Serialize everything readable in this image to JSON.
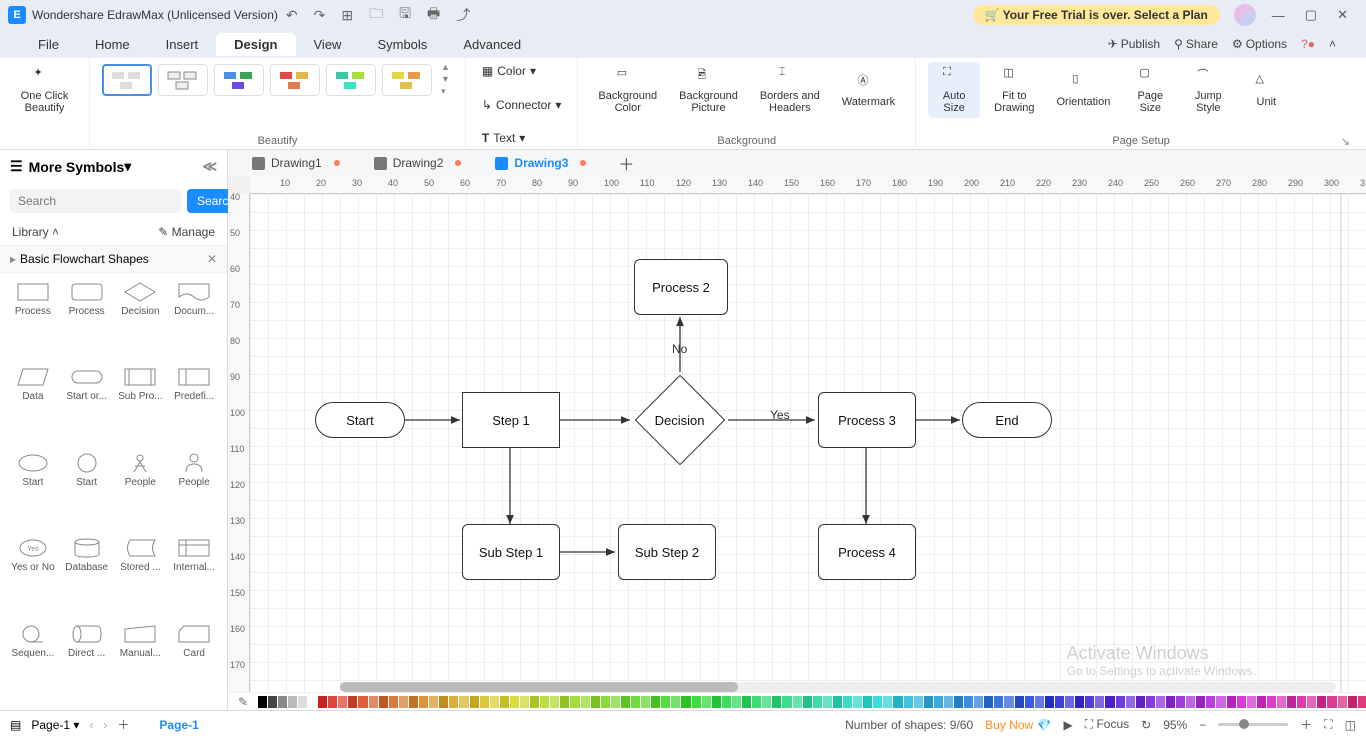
{
  "app": {
    "title": "Wondershare EdrawMax (Unlicensed Version)",
    "trial": "Your Free Trial is over. Select a Plan"
  },
  "menu": {
    "items": [
      "File",
      "Home",
      "Insert",
      "Design",
      "View",
      "Symbols",
      "Advanced"
    ],
    "active": "Design",
    "right": {
      "publish": "Publish",
      "share": "Share",
      "options": "Options"
    }
  },
  "ribbon": {
    "beautify": {
      "one_click": "One Click\nBeautify",
      "label": "Beautify"
    },
    "dropdowns": {
      "color": "Color",
      "connector": "Connector",
      "text": "Text"
    },
    "bg": {
      "bgcolor": "Background\nColor",
      "bgpic": "Background\nPicture",
      "borders": "Borders and\nHeaders",
      "watermark": "Watermark",
      "label": "Background"
    },
    "page": {
      "auto": "Auto\nSize",
      "fit": "Fit to\nDrawing",
      "orient": "Orientation",
      "size": "Page\nSize",
      "jump": "Jump\nStyle",
      "unit": "Unit",
      "label": "Page Setup"
    }
  },
  "sidebar": {
    "more": "More Symbols",
    "search_ph": "Search",
    "search_btn": "Search",
    "library": "Library",
    "manage": "Manage",
    "section": "Basic Flowchart Shapes",
    "shapes": [
      "Process",
      "Process",
      "Decision",
      "Docum...",
      "Data",
      "Start or...",
      "Sub Pro...",
      "Predefi...",
      "Start",
      "Start",
      "People",
      "People",
      "Yes or No",
      "Database",
      "Stored ...",
      "Internal...",
      "Sequen...",
      "Direct ...",
      "Manual...",
      "Card"
    ]
  },
  "tabs": {
    "t1": "Drawing1",
    "t2": "Drawing2",
    "t3": "Drawing3"
  },
  "flow": {
    "start": "Start",
    "step1": "Step 1",
    "decision": "Decision",
    "proc2": "Process 2",
    "proc3": "Process 3",
    "end": "End",
    "sub1": "Sub Step 1",
    "sub2": "Sub Step 2",
    "proc4": "Process 4",
    "yes": "Yes",
    "no": "No"
  },
  "status": {
    "page": "Page-1",
    "page_left": "Page-1",
    "shapes": "Number of shapes: 9/60",
    "buy": "Buy Now",
    "focus": "Focus",
    "zoom": "95%"
  },
  "wm": {
    "l1": "Activate Windows",
    "l2": "Go to Settings to activate Windows."
  }
}
